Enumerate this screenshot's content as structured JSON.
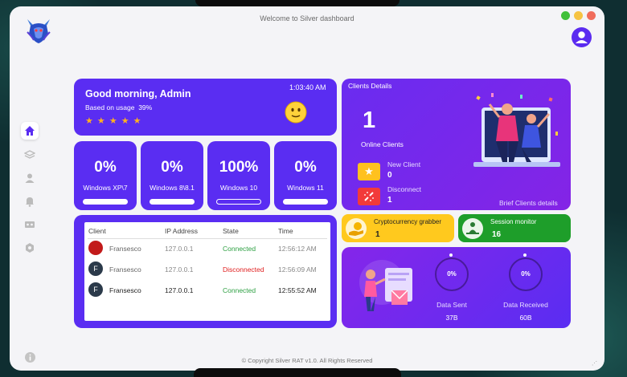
{
  "window": {
    "title": "Welcome to Silver dashboard",
    "footer": "© Copyright Silver RAT v1.0. All Rights Reserved"
  },
  "colors": {
    "accent": "#5a2df2",
    "gradient_end": "#8a24e8",
    "connected": "#2ea043",
    "disconnected": "#e02020",
    "yellow_card": "#ffc91e",
    "green_card": "#1e9e2a"
  },
  "sidebar": {
    "items": [
      {
        "icon": "home-icon",
        "active": true
      },
      {
        "icon": "layers-icon",
        "active": false
      },
      {
        "icon": "user-icon",
        "active": false
      },
      {
        "icon": "bell-icon",
        "active": false
      },
      {
        "icon": "cassette-icon",
        "active": false
      },
      {
        "icon": "settings-icon",
        "active": false
      },
      {
        "icon": "info-icon",
        "active": false
      }
    ]
  },
  "greeting": {
    "title": "Good morning, Admin",
    "usage_label": "Based on usage",
    "usage_value": "39%",
    "time": "1:03:40 AM",
    "stars": "★ ★ ★ ★ ★"
  },
  "os_stats": [
    {
      "pct": "0%",
      "name": "Windows XP\\7",
      "fill": 1.0
    },
    {
      "pct": "0%",
      "name": "Windows 8\\8.1",
      "fill": 1.0
    },
    {
      "pct": "100%",
      "name": "Windows 10",
      "fill": 0.0
    },
    {
      "pct": "0%",
      "name": "Windows 11",
      "fill": 1.0
    }
  ],
  "clients_table": {
    "headers": [
      "Client",
      "IP Address",
      "State",
      "Time"
    ],
    "rows": [
      {
        "avatar": "",
        "name": "Fransesco",
        "ip": "127.0.0.1",
        "state": "Connected",
        "time": "12:56:12 AM",
        "avatar_color": "#c21a1a"
      },
      {
        "avatar": "F",
        "name": "Fransesco",
        "ip": "127.0.0.1",
        "state": "Disconnected",
        "time": "12:56:09 AM",
        "avatar_color": "#2b3a4a"
      },
      {
        "avatar": "F",
        "name": "Fransesco",
        "ip": "127.0.0.1",
        "state": "Connected",
        "time": "12:55:52 AM",
        "avatar_color": "#2b3a4a"
      }
    ]
  },
  "clients_details": {
    "title": "Clients Details",
    "online_count": "1",
    "online_label": "Online Clients",
    "new_label": "New Client",
    "new_count": "0",
    "disconnect_label": "Disconnect",
    "disconnect_count": "1",
    "link": "Brief Clients details"
  },
  "crypto": {
    "label": "Cryptocurrency grabber",
    "count": "1"
  },
  "session": {
    "label": "Session monitor",
    "count": "16"
  },
  "data": {
    "sent_pct": "0%",
    "sent_label": "Data Sent",
    "sent_value": "37B",
    "recv_pct": "0%",
    "recv_label": "Data Received",
    "recv_value": "60B"
  }
}
